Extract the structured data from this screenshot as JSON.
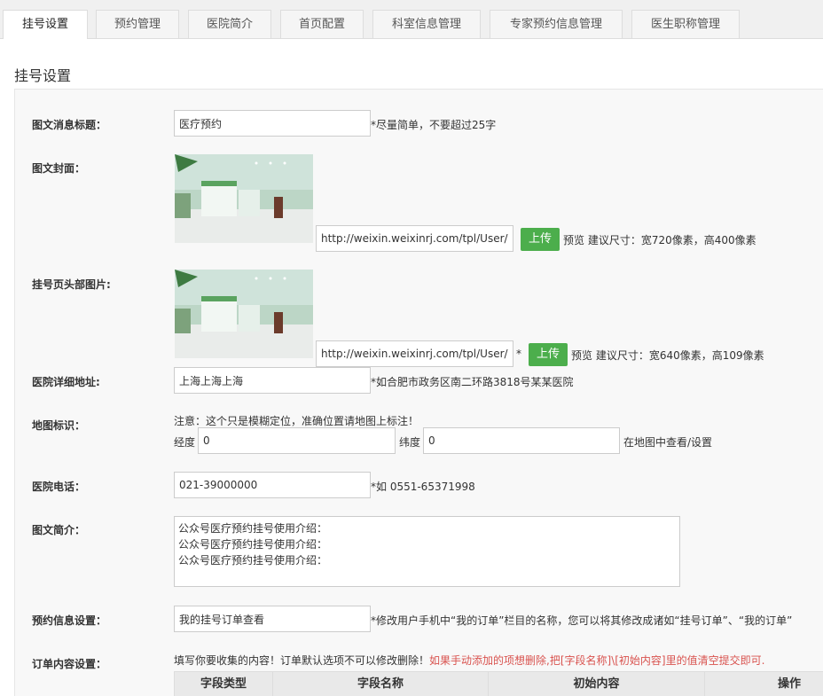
{
  "tabs": [
    "挂号设置",
    "预约管理",
    "医院简介",
    "首页配置",
    "科室信息管理",
    "专家预约信息管理",
    "医生职称管理"
  ],
  "page_title": "挂号设置",
  "fields": {
    "title": {
      "label": "图文消息标题：",
      "value": "医疗预约",
      "hint": "*尽量简单，不要超过25字"
    },
    "cover": {
      "label": "图文封面：",
      "url": "http://weixin.weixinrj.com/tpl/User/c",
      "upload": "上传",
      "hint": "预览 建议尺寸：宽720像素，高400像素"
    },
    "header_img": {
      "label": "挂号页头部图片:",
      "url": "http://weixin.weixinrj.com/tpl/User/c",
      "star": "*",
      "upload": "上传",
      "hint": "预览 建议尺寸：宽640像素，高109像素"
    },
    "address": {
      "label": "医院详细地址:",
      "value": "上海上海上海",
      "hint": "*如合肥市政务区南二环路3818号某某医院"
    },
    "map": {
      "label": "地图标识：",
      "note": "注意：这个只是模糊定位，准确位置请地图上标注！",
      "lng_label": "经度",
      "lng": "0",
      "lat_label": "纬度",
      "lat": "0",
      "link": "在地图中查看/设置"
    },
    "phone": {
      "label": "医院电话：",
      "value": "021-39000000",
      "hint": "*如 0551-65371998"
    },
    "intro": {
      "label": "图文简介：",
      "value": "公众号医疗预约挂号使用介绍：\n公众号医疗预约挂号使用介绍：\n公众号医疗预约挂号使用介绍："
    },
    "booking": {
      "label": "预约信息设置：",
      "value": "我的挂号订单查看",
      "hint": "*修改用户手机中“我的订单”栏目的名称，您可以将其修改成诸如“挂号订单”、“我的订单”"
    },
    "order": {
      "label": "订单内容设置：",
      "note": "填写你要收集的内容！订单默认选项不可以修改删除！",
      "note_red": "如果手动添加的项想删除,把[字段名称]\\[初始内容]里的值清空提交即可."
    }
  },
  "table_headers": [
    "字段类型",
    "字段名称",
    "初始内容",
    "操作"
  ],
  "colors": {
    "upload_green": "#4cae4c",
    "warning_red": "#d9534f"
  }
}
